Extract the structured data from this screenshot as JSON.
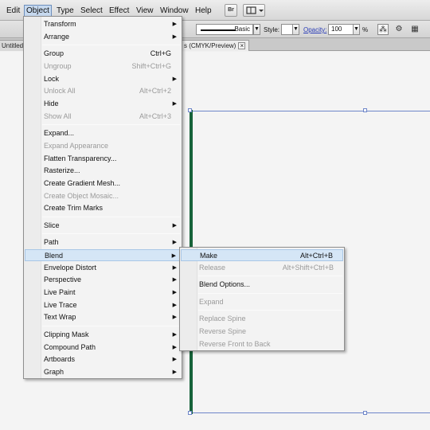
{
  "menubar": {
    "items": [
      {
        "label": "Edit"
      },
      {
        "label": "Object"
      },
      {
        "label": "Type"
      },
      {
        "label": "Select"
      },
      {
        "label": "Effect"
      },
      {
        "label": "View"
      },
      {
        "label": "Window"
      },
      {
        "label": "Help"
      }
    ],
    "bridge_label": "Br",
    "arrange_icon": "arrange-documents-icon"
  },
  "controlbar": {
    "stroke_style_label": "Basic",
    "style_label": "Style:",
    "opacity_label": "Opacity:",
    "opacity_value": "100",
    "opacity_unit": "%"
  },
  "tabs": [
    {
      "label": "Untitled"
    },
    {
      "label": "s (CMYK/Preview)",
      "close": "×"
    }
  ],
  "object_menu": {
    "items": [
      {
        "label": "Transform",
        "submenu": true
      },
      {
        "label": "Arrange",
        "submenu": true
      },
      {
        "label": "Group",
        "shortcut": "Ctrl+G"
      },
      {
        "label": "Ungroup",
        "shortcut": "Shift+Ctrl+G",
        "disabled": true
      },
      {
        "label": "Lock",
        "submenu": true
      },
      {
        "label": "Unlock All",
        "shortcut": "Alt+Ctrl+2",
        "disabled": true
      },
      {
        "label": "Hide",
        "submenu": true
      },
      {
        "label": "Show All",
        "shortcut": "Alt+Ctrl+3",
        "disabled": true
      },
      {
        "label": "Expand..."
      },
      {
        "label": "Expand Appearance",
        "disabled": true
      },
      {
        "label": "Flatten Transparency..."
      },
      {
        "label": "Rasterize..."
      },
      {
        "label": "Create Gradient Mesh..."
      },
      {
        "label": "Create Object Mosaic...",
        "disabled": true
      },
      {
        "label": "Create Trim Marks"
      },
      {
        "label": "Slice",
        "submenu": true
      },
      {
        "label": "Path",
        "submenu": true
      },
      {
        "label": "Blend",
        "submenu": true,
        "highlighted": true
      },
      {
        "label": "Envelope Distort",
        "submenu": true
      },
      {
        "label": "Perspective",
        "submenu": true
      },
      {
        "label": "Live Paint",
        "submenu": true
      },
      {
        "label": "Live Trace",
        "submenu": true
      },
      {
        "label": "Text Wrap",
        "submenu": true
      },
      {
        "label": "Clipping Mask",
        "submenu": true
      },
      {
        "label": "Compound Path",
        "submenu": true
      },
      {
        "label": "Artboards",
        "submenu": true
      },
      {
        "label": "Graph",
        "submenu": true
      }
    ]
  },
  "blend_submenu": {
    "items": [
      {
        "label": "Make",
        "shortcut": "Alt+Ctrl+B",
        "highlighted": true
      },
      {
        "label": "Release",
        "shortcut": "Alt+Shift+Ctrl+B",
        "disabled": true
      },
      {
        "label": "Blend Options..."
      },
      {
        "label": "Expand",
        "disabled": true
      },
      {
        "label": "Replace Spine",
        "disabled": true
      },
      {
        "label": "Reverse Spine",
        "disabled": true
      },
      {
        "label": "Reverse Front to Back",
        "disabled": true
      }
    ]
  },
  "colors": {
    "menu_highlight": "#d5e6f6",
    "selection_blue": "#6e86c9",
    "path_green": "#17633a",
    "disabled_text": "#9a9a9a"
  }
}
